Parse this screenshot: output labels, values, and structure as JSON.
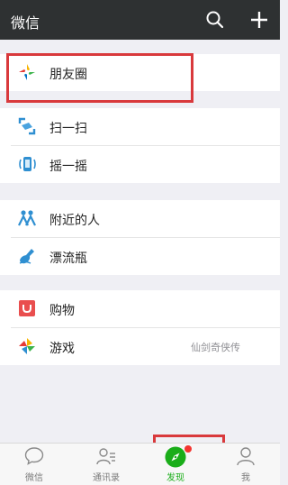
{
  "header": {
    "title": "微信"
  },
  "group1": {
    "moments": "朋友圈"
  },
  "group2": {
    "scan": "扫一扫",
    "shake": "摇一摇"
  },
  "group3": {
    "nearby": "附近的人",
    "bottle": "漂流瓶"
  },
  "group4": {
    "shopping": "购物",
    "games": "游戏",
    "games_meta": "仙剑奇侠传"
  },
  "tabs": [
    {
      "label": "微信"
    },
    {
      "label": "通讯录"
    },
    {
      "label": "发现"
    },
    {
      "label": "我"
    }
  ],
  "colors": {
    "accent": "#1aad19",
    "highlight": "#d9393c",
    "topbar": "#2e3132",
    "background": "#efeff4"
  }
}
